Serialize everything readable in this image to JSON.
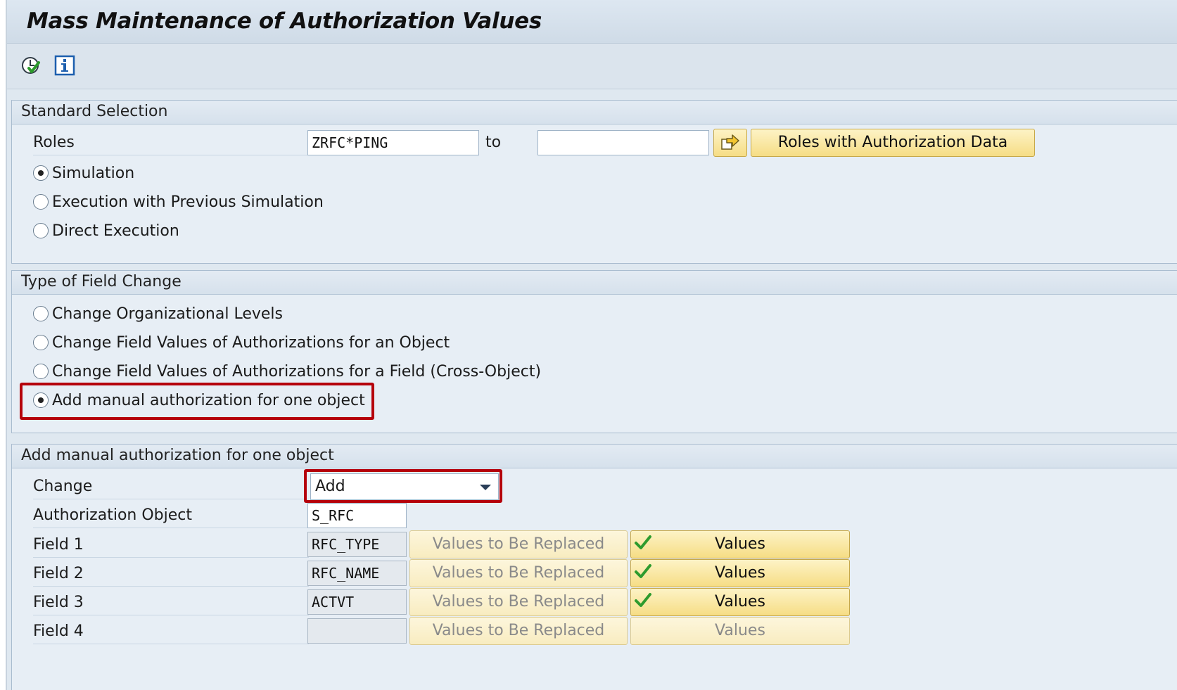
{
  "window": {
    "title": "Mass Maintenance of Authorization Values"
  },
  "toolbar": {
    "icons": [
      "execute-icon",
      "info-icon"
    ]
  },
  "standard_selection": {
    "header": "Standard Selection",
    "roles_label": "Roles",
    "roles_from": "ZRFC*PING",
    "to_label": "to",
    "roles_to": "",
    "multiple_selection_icon": "arrow-right-icon",
    "roles_button": "Roles with Authorization Data",
    "modes": [
      {
        "label": "Simulation",
        "checked": true
      },
      {
        "label": "Execution with Previous Simulation",
        "checked": false
      },
      {
        "label": "Direct Execution",
        "checked": false
      }
    ]
  },
  "field_change": {
    "header": "Type of Field Change",
    "options": [
      {
        "label": "Change Organizational Levels",
        "checked": false
      },
      {
        "label": "Change Field Values of Authorizations for an Object",
        "checked": false
      },
      {
        "label": "Change Field Values of Authorizations for a Field (Cross-Object)",
        "checked": false
      },
      {
        "label": "Add manual authorization for one object",
        "checked": true
      }
    ]
  },
  "manual_auth": {
    "header": "Add manual authorization for one object",
    "change_label": "Change",
    "change_value": "Add",
    "object_label": "Authorization Object",
    "object_value": "S_RFC",
    "fields": [
      {
        "label": "Field 1",
        "value": "RFC_TYPE",
        "replace_label": "Values to Be Replaced",
        "values_label": "Values",
        "checked": true
      },
      {
        "label": "Field 2",
        "value": "RFC_NAME",
        "replace_label": "Values to Be Replaced",
        "values_label": "Values",
        "checked": true
      },
      {
        "label": "Field 3",
        "value": "ACTVT",
        "replace_label": "Values to Be Replaced",
        "values_label": "Values",
        "checked": true
      },
      {
        "label": "Field 4",
        "value": "",
        "replace_label": "Values to Be Replaced",
        "values_label": "Values",
        "checked": false
      }
    ]
  },
  "colors": {
    "highlight": "#b5000b",
    "button_yellow": "#f6dd85",
    "panel_bg": "#e7eef5"
  }
}
